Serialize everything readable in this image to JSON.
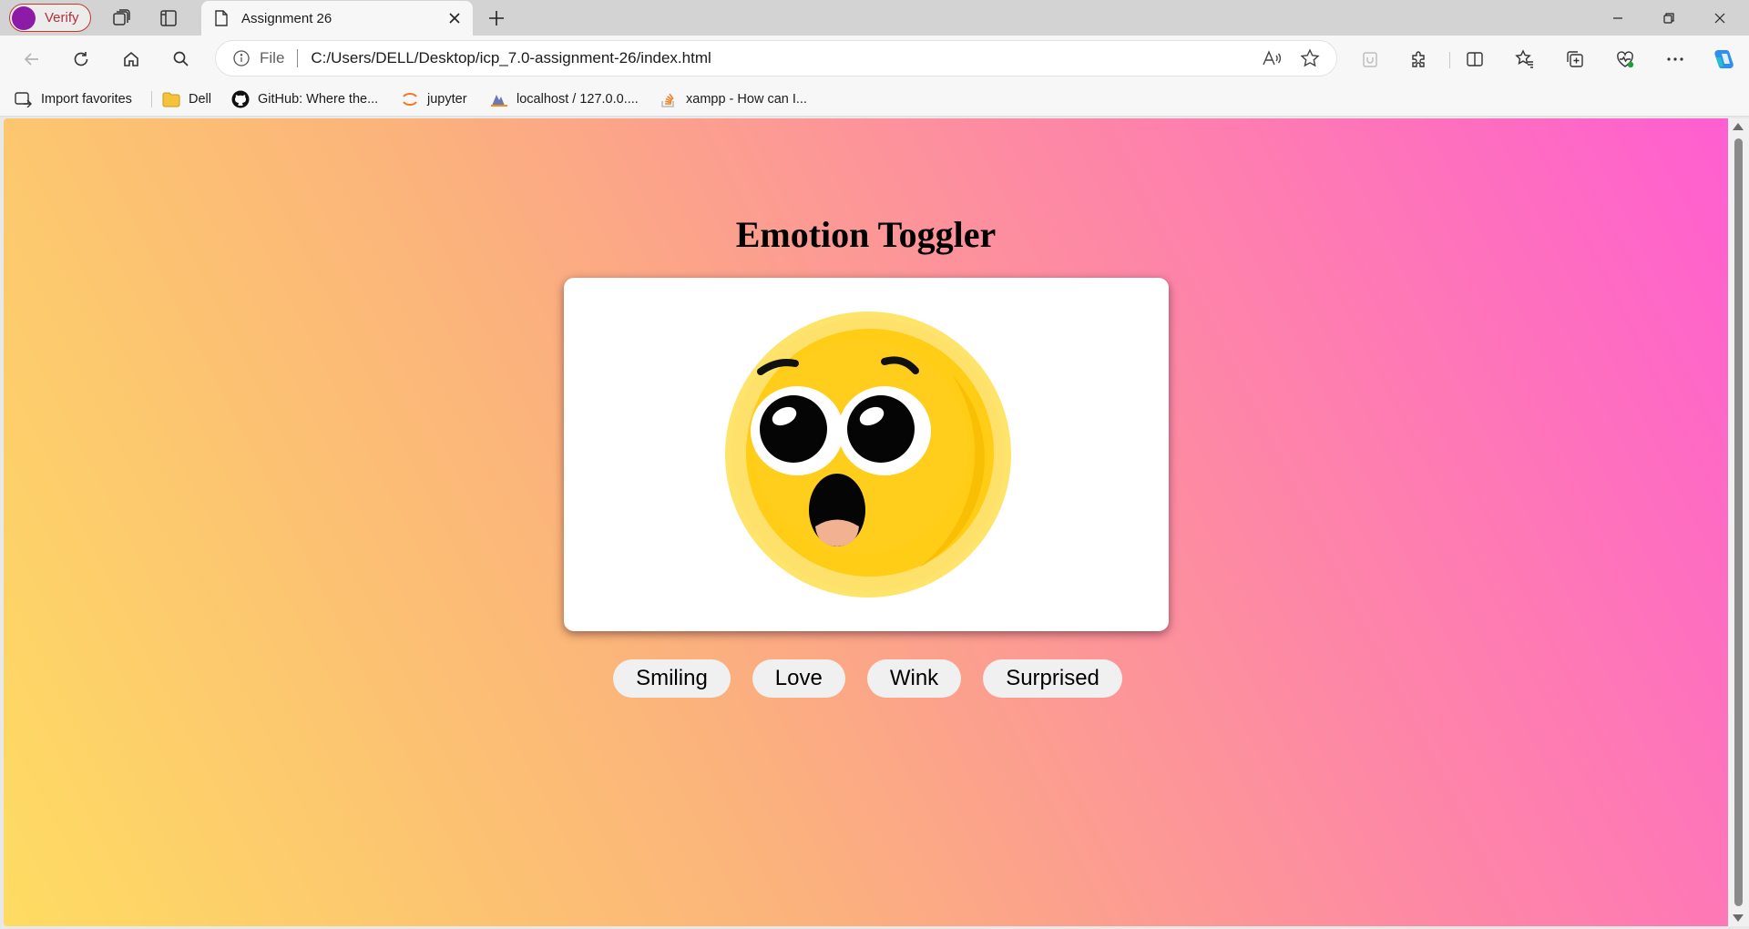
{
  "browser": {
    "profile_label": "Verify",
    "tab": {
      "title": "Assignment 26"
    },
    "address": {
      "scheme_label": "File",
      "url": "C:/Users/DELL/Desktop/icp_7.0-assignment-26/index.html"
    },
    "bookmarks": [
      {
        "label": "Import favorites",
        "icon": "import-icon"
      },
      {
        "label": "Dell",
        "icon": "folder-icon"
      },
      {
        "label": "GitHub: Where the...",
        "icon": "github-icon"
      },
      {
        "label": "jupyter",
        "icon": "jupyter-icon"
      },
      {
        "label": "localhost / 127.0.0....",
        "icon": "phpmyadmin-icon"
      },
      {
        "label": "xampp - How can I...",
        "icon": "stackoverflow-icon"
      }
    ]
  },
  "page": {
    "title": "Emotion Toggler",
    "current_emotion": "surprised-emoji",
    "buttons": [
      "Smiling",
      "Love",
      "Wink",
      "Surprised"
    ]
  },
  "colors": {
    "gradient": [
      "#fedc62",
      "#fbb27c",
      "#fd8da0",
      "#ff5ed0"
    ],
    "emoji_face": "#fcc419",
    "profile_avatar": "#8e1aa8"
  }
}
